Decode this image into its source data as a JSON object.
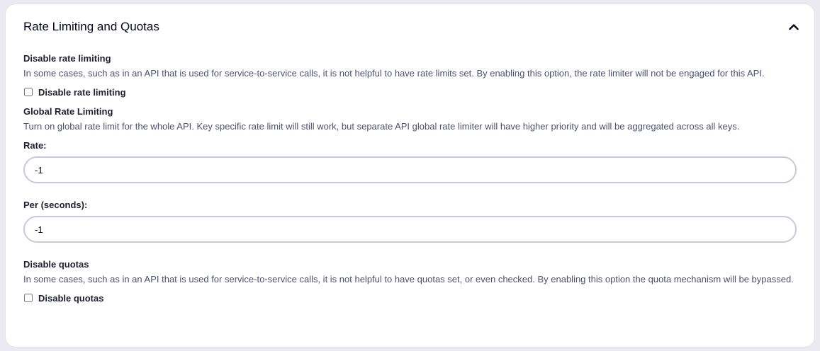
{
  "panel": {
    "title": "Rate Limiting and Quotas",
    "collapse_icon": "chevron-up-icon"
  },
  "disable_rate_limiting": {
    "title": "Disable rate limiting",
    "description": "In some cases, such as in an API that is used for service-to-service calls, it is not helpful to have rate limits set. By enabling this option, the rate limiter will not be engaged for this API.",
    "checkbox_label": "Disable rate limiting",
    "checked": false
  },
  "global_rate_limiting": {
    "title": "Global Rate Limiting",
    "description": "Turn on global rate limit for the whole API. Key specific rate limit will still work, but separate API global rate limiter will have higher priority and will be aggregated across all keys.",
    "rate_label": "Rate:",
    "rate_value": "-1",
    "per_label": "Per (seconds):",
    "per_value": "-1"
  },
  "disable_quotas": {
    "title": "Disable quotas",
    "description": "In some cases, such as in an API that is used for service-to-service calls, it is not helpful to have quotas set, or even checked. By enabling this option the quota mechanism will be bypassed.",
    "checkbox_label": "Disable quotas",
    "checked": false
  }
}
